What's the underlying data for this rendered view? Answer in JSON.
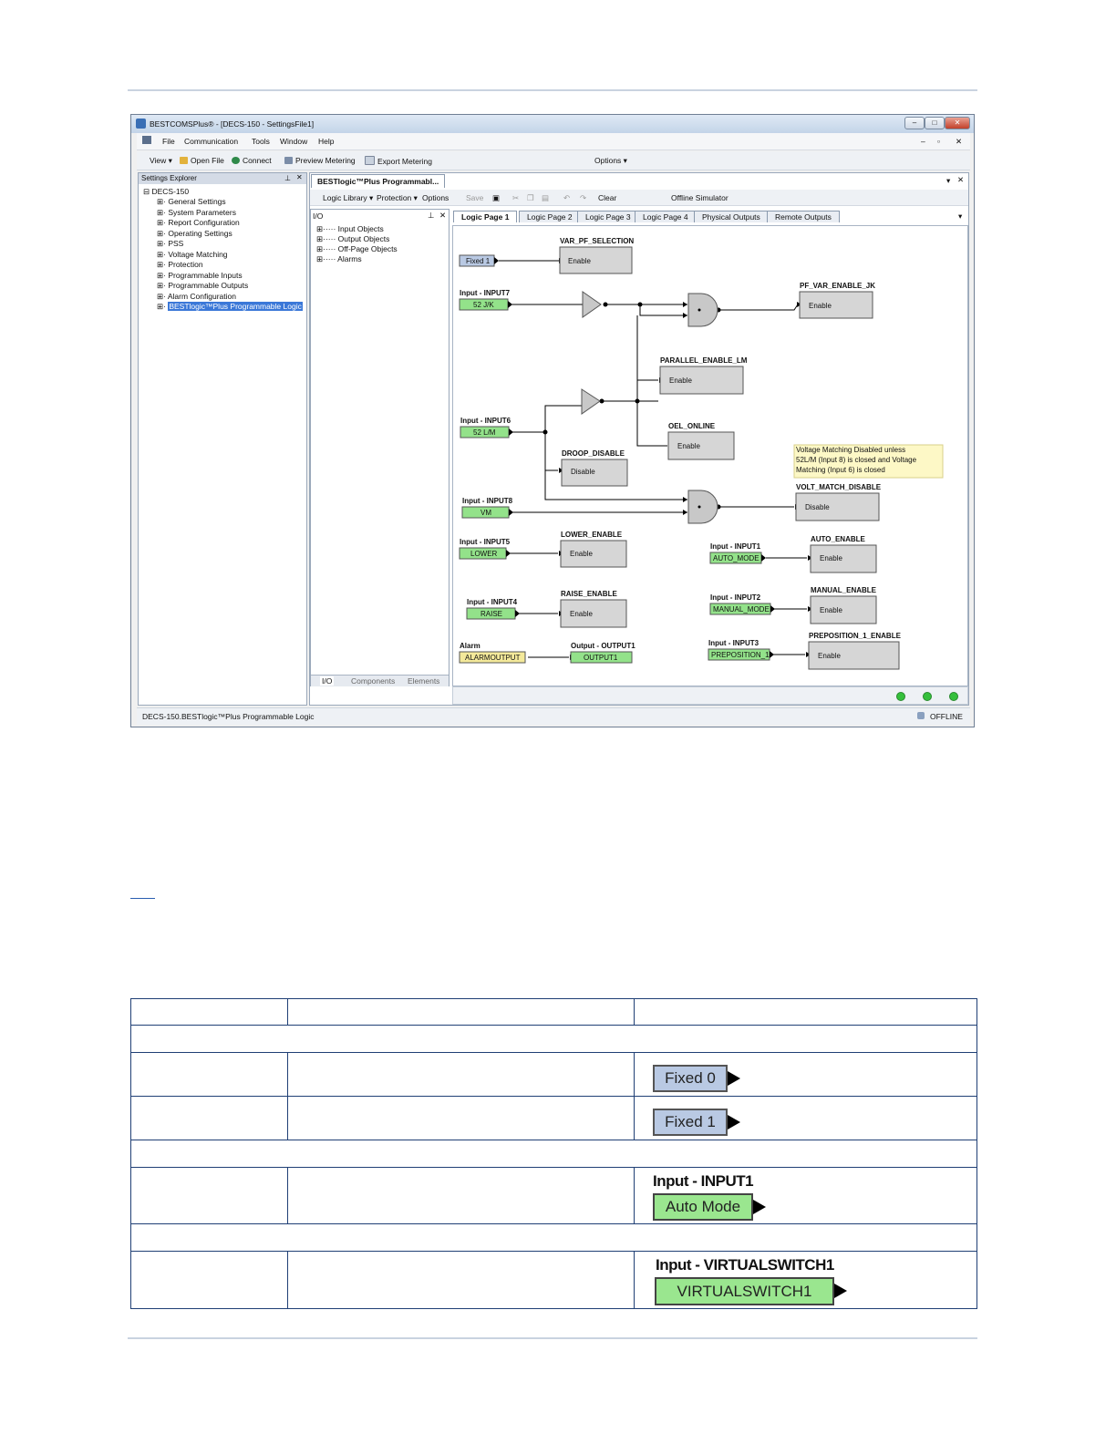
{
  "window": {
    "title": "BESTCOMSPlus® - [DECS-150 - SettingsFile1]",
    "menu": [
      "File",
      "Communication",
      "Tools",
      "Window",
      "Help"
    ],
    "toolbar": {
      "view": "View ▾",
      "open_file": "Open File",
      "connect": "Connect",
      "preview_metering": "Preview Metering",
      "export_metering": "Export Metering",
      "options": "Options ▾"
    }
  },
  "explorer": {
    "title": "Settings Explorer",
    "root": "DECS-150",
    "items": [
      "General Settings",
      "System Parameters",
      "Report Configuration",
      "Operating Settings",
      "PSS",
      "Voltage Matching",
      "Protection",
      "Programmable Inputs",
      "Programmable Outputs",
      "Alarm Configuration",
      "BESTlogic™Plus Programmable Logic"
    ]
  },
  "doc": {
    "tab": "BESTlogic™Plus Programmabl...",
    "logic_toolbar": {
      "logic_library": "Logic Library ▾",
      "protection": "Protection ▾",
      "options": "Options",
      "save": "Save",
      "clear": "Clear",
      "offline_simulator": "Offline Simulator"
    },
    "page_tabs": [
      "Logic Page 1",
      "Logic Page 2",
      "Logic Page 3",
      "Logic Page 4",
      "Physical Outputs",
      "Remote Outputs"
    ]
  },
  "io": {
    "title": "I/O",
    "items": [
      "Input Objects",
      "Output Objects",
      "Off-Page Objects",
      "Alarms"
    ],
    "tabs": [
      "I/O",
      "Components",
      "Elements"
    ]
  },
  "logic": {
    "fixed1": "Fixed 1",
    "var_pf_title": "VAR_PF_SELECTION",
    "enable": "Enable",
    "disable": "Disable",
    "in7_title": "Input - INPUT7",
    "in7_box": "52 J/K",
    "pf_var_title": "PF_VAR_ENABLE_JK",
    "parallel_title": "PARALLEL_ENABLE_LM",
    "in6_title": "Input - INPUT6",
    "in6_box": "52 L/M",
    "oel_title": "OEL_ONLINE",
    "droop_title": "DROOP_DISABLE",
    "note": [
      "Voltage Matching Disabled unless",
      "52L/M (Input 8) is closed and Voltage",
      "Matching (Input 6) is closed"
    ],
    "in8_title": "Input - INPUT8",
    "in8_box": "VM",
    "volt_title": "VOLT_MATCH_DISABLE",
    "in5_title": "Input - INPUT5",
    "in5_box": "LOWER",
    "lower_title": "LOWER_ENABLE",
    "in1_title": "Input - INPUT1",
    "in1_box": "AUTO_MODE",
    "auto_title": "AUTO_ENABLE",
    "in4_title": "Input - INPUT4",
    "in4_box": "RAISE",
    "raise_title": "RAISE_ENABLE",
    "in2_title": "Input - INPUT2",
    "in2_box": "MANUAL_MODE",
    "manual_title": "MANUAL_ENABLE",
    "alarm_title": "Alarm",
    "alarm_box": "ALARMOUTPUT",
    "out_title": "Output - OUTPUT1",
    "out_box": "OUTPUT1",
    "in3_title": "Input - INPUT3",
    "in3_box": "PREPOSITION_1",
    "prep_title": "PREPOSITION_1_ENABLE"
  },
  "status": {
    "path": "DECS-150.BESTlogic™Plus Programmable Logic",
    "state": "OFFLINE"
  },
  "table": {
    "fixed0": "Fixed 0",
    "fixed1": "Fixed 1",
    "input1_label": "Input - INPUT1",
    "input1_box": "Auto Mode",
    "vs_label": "Input - VIRTUALSWITCH1",
    "vs_box": "VIRTUALSWITCH1"
  }
}
